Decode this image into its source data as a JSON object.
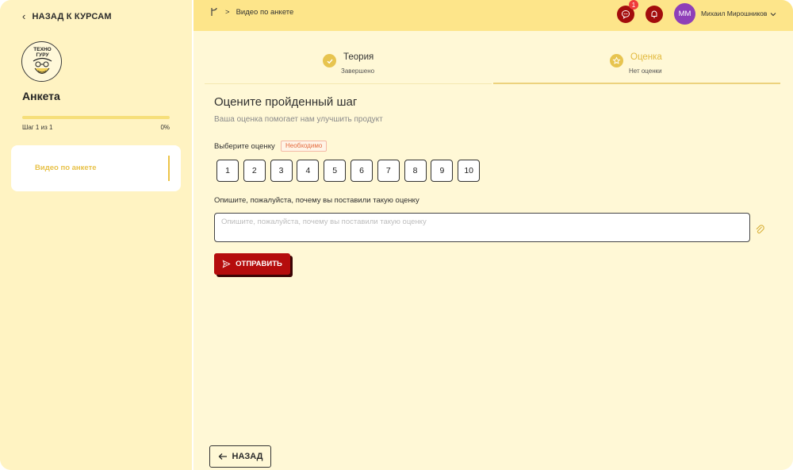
{
  "sidebar": {
    "back_label": "НАЗАД К КУРСАМ",
    "logo_text": "ТЕХНО\nГУРУ",
    "course_title": "Анкета",
    "progress_fraction": 0.0,
    "step_label": "Шаг 1 из 1",
    "progress_label": "0%",
    "lessons": [
      {
        "label": "Видео по анкете"
      }
    ]
  },
  "topbar": {
    "breadcrumb": [
      "Видео по анкете"
    ],
    "chat_badge": "1",
    "user_initials": "ММ",
    "user_name": "Михаил Мирошников"
  },
  "stepper": [
    {
      "title": "Теория",
      "status": "Завершено",
      "state": "done"
    },
    {
      "title": "Оценка",
      "status": "Нет оценки",
      "state": "active"
    }
  ],
  "main": {
    "title": "Оцените пройденный шаг",
    "subtitle": "Ваша оценка помогает нам улучшить продукт",
    "choose_label": "Выберите оценку",
    "required_label": "Необходимо",
    "ratings": [
      "1",
      "2",
      "3",
      "4",
      "5",
      "6",
      "7",
      "8",
      "9",
      "10"
    ],
    "comment_label": "Опишите, пожалуйста, почему вы поставили такую оценку",
    "comment_placeholder": "Опишите, пожалуйста, почему вы поставили такую оценку",
    "comment_value": "",
    "submit_label": "ОТПРАВИТЬ",
    "back_label": "НАЗАД"
  },
  "colors": {
    "accent_red": "#b50d0d",
    "accent_yellow": "#f0c93a",
    "topbar_bg": "#fde58a",
    "avatar_bg": "#8e3fb8"
  }
}
